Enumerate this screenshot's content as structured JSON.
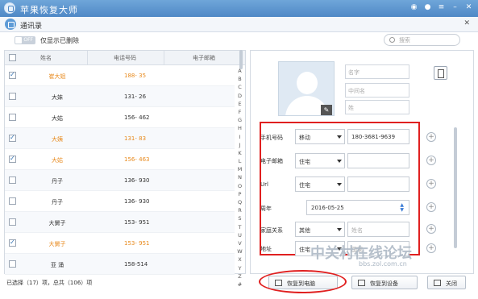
{
  "app": {
    "title": "苹果恢复大师"
  },
  "panel": {
    "title": "通讯录"
  },
  "filter": {
    "toggle_state": "OFF",
    "label": "仅显示已删除"
  },
  "search": {
    "placeholder": "搜索"
  },
  "table": {
    "headers": [
      "姓名",
      "电话号码",
      "电子邮箱"
    ],
    "rows": [
      {
        "name": "崔大姐",
        "phone": "188-     35",
        "checked": true,
        "deleted": true
      },
      {
        "name": "大妹",
        "phone": "131-     26",
        "checked": false,
        "deleted": false
      },
      {
        "name": "大姑",
        "phone": "156-    462",
        "checked": false,
        "deleted": false
      },
      {
        "name": "大姨",
        "phone": "131-     83",
        "checked": true,
        "deleted": true
      },
      {
        "name": "大姑",
        "phone": "156-    463",
        "checked": true,
        "deleted": true
      },
      {
        "name": "丹子",
        "phone": "136-     930",
        "checked": false,
        "deleted": false
      },
      {
        "name": "丹子",
        "phone": "136-     930",
        "checked": false,
        "deleted": false
      },
      {
        "name": "大舅子",
        "phone": "153-     951",
        "checked": false,
        "deleted": false
      },
      {
        "name": "大舅子",
        "phone": "153-     951",
        "checked": true,
        "deleted": true
      },
      {
        "name": "亚 涌",
        "phone": "158-514",
        "checked": false,
        "deleted": false
      }
    ]
  },
  "alphabet": [
    "A",
    "B",
    "C",
    "D",
    "E",
    "F",
    "G",
    "H",
    "I",
    "J",
    "K",
    "L",
    "M",
    "N",
    "O",
    "P",
    "Q",
    "R",
    "S",
    "T",
    "U",
    "V",
    "W",
    "X",
    "Y",
    "Z",
    "#"
  ],
  "status": {
    "text": "已选择（17）项，总共（106）项"
  },
  "detail": {
    "name_placeholders": [
      "名字",
      "中间名",
      "姓"
    ],
    "fields": [
      {
        "label": "手机号码",
        "type": "移动",
        "value": "180-3681-9639"
      },
      {
        "label": "电子邮箱",
        "type": "住宅",
        "value": ""
      },
      {
        "label": "Url",
        "type": "住宅",
        "value": ""
      },
      {
        "label": "周年",
        "value": "2016-05-25"
      },
      {
        "label": "家庭关系",
        "type": "其他",
        "placeholder": "姓名"
      },
      {
        "label": "地址",
        "type": "住宅",
        "placeholder": "国家"
      }
    ]
  },
  "buttons": {
    "restore_pc": "恢复到电脑",
    "restore_device": "恢复到设备",
    "close": "关闭"
  },
  "watermark": {
    "text": "中关村在线论坛",
    "url": "bbs.zol.com.cn"
  }
}
